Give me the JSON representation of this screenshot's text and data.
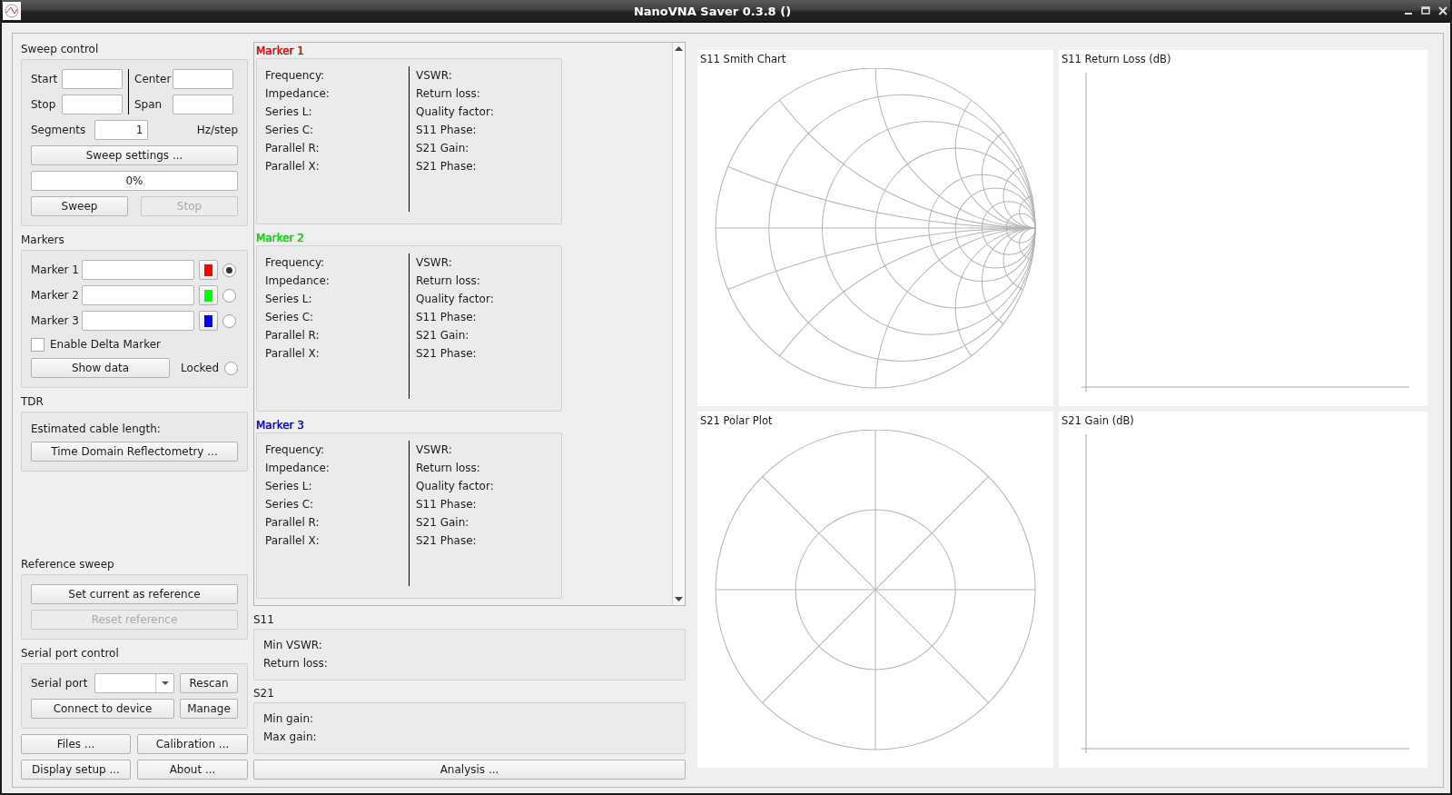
{
  "window": {
    "title": "NanoVNA Saver 0.3.8 ()"
  },
  "sweep_control": {
    "title": "Sweep control",
    "start": {
      "label": "Start"
    },
    "stop": {
      "label": "Stop"
    },
    "center": {
      "label": "Center"
    },
    "span": {
      "label": "Span"
    },
    "segments": {
      "label": "Segments",
      "value": "1"
    },
    "step_text": "Hz/step",
    "settings_button": "Sweep settings ...",
    "progress": {
      "level": 0,
      "text": "0%"
    },
    "sweep_button": {
      "label": "Sweep",
      "disabled": false
    },
    "stop_button": {
      "label": "Stop",
      "disabled": true
    }
  },
  "markers": {
    "title": "Markers",
    "items": [
      {
        "label": "Marker 1",
        "color": "#ff0000",
        "selected": true
      },
      {
        "label": "Marker 2",
        "color": "#00ff00",
        "selected": false
      },
      {
        "label": "Marker 3",
        "color": "#0000ff",
        "selected": false
      }
    ],
    "delta": {
      "label": "Enable Delta Marker",
      "checked": false
    },
    "show_data_button": "Show data",
    "locked": {
      "label": "Locked",
      "checked": false
    }
  },
  "tdr": {
    "title": "TDR",
    "estimate_label": "Estimated cable length:",
    "button": "Time Domain Reflectometry ..."
  },
  "reference_sweep": {
    "title": "Reference sweep",
    "buttons": [
      {
        "label": "Set current as reference",
        "disabled": false
      },
      {
        "label": "Reset reference",
        "disabled": true
      }
    ]
  },
  "serial_port": {
    "title": "Serial port control",
    "label": "Serial port",
    "rescan_button": "Rescan",
    "connect_button": "Connect to device",
    "manage_button": "Manage"
  },
  "bottom_buttons": [
    "Files ...",
    "Calibration ...",
    "Display setup ...",
    "About ..."
  ],
  "marker_panels": [
    {
      "title": "Marker 1",
      "color": "#ff0000",
      "left": [
        "Frequency:",
        "Impedance:",
        "Series L:",
        "Series C:",
        "Parallel R:",
        "Parallel X:"
      ],
      "right": [
        "VSWR:",
        "Return loss:",
        "Quality factor:",
        "S11 Phase:",
        "S21 Gain:",
        "S21 Phase:"
      ]
    },
    {
      "title": "Marker 2",
      "color": "#00ff00",
      "left": [
        "Frequency:",
        "Impedance:",
        "Series L:",
        "Series C:",
        "Parallel R:",
        "Parallel X:"
      ],
      "right": [
        "VSWR:",
        "Return loss:",
        "Quality factor:",
        "S11 Phase:",
        "S21 Gain:",
        "S21 Phase:"
      ]
    },
    {
      "title": "Marker 3",
      "color": "#0000ff",
      "left": [
        "Frequency:",
        "Impedance:",
        "Series L:",
        "Series C:",
        "Parallel R:",
        "Parallel X:"
      ],
      "right": [
        "VSWR:",
        "Return loss:",
        "Quality factor:",
        "S11 Phase:",
        "S21 Gain:",
        "S21 Phase:"
      ]
    }
  ],
  "s11": {
    "title": "S11",
    "fields": [
      "Min VSWR:",
      "Return loss:"
    ]
  },
  "s21": {
    "title": "S21",
    "fields": [
      "Min gain:",
      "Max gain:"
    ]
  },
  "analysis_button": "Analysis ...",
  "charts": [
    {
      "title": "S11 Smith Chart",
      "kind": "smith"
    },
    {
      "title": "S11 Return Loss (dB)",
      "kind": "cartesian"
    },
    {
      "title": "S21 Polar Plot",
      "kind": "polar"
    },
    {
      "title": "S21 Gain (dB)",
      "kind": "cartesian"
    }
  ]
}
